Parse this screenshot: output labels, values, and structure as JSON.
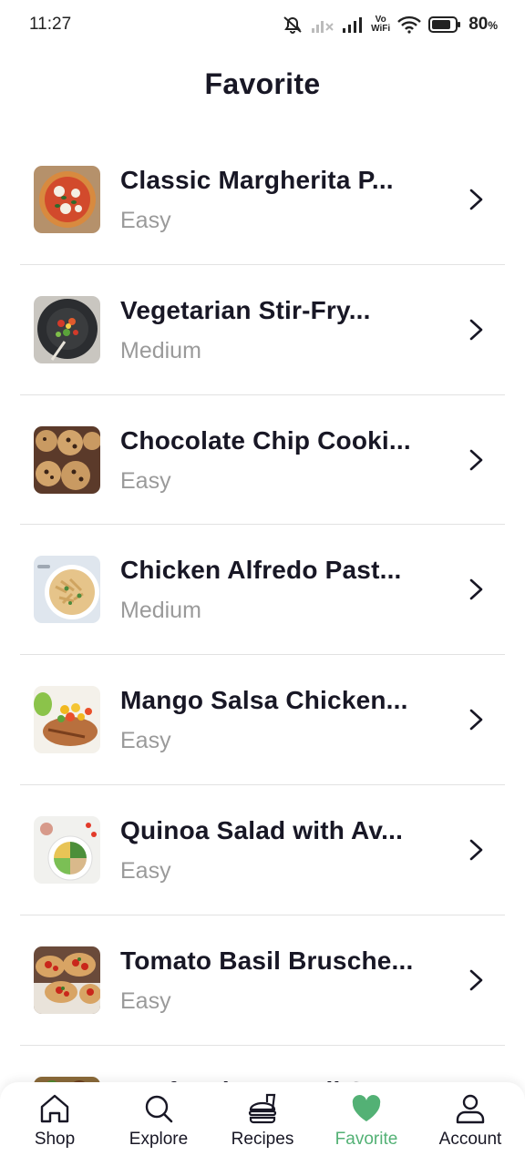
{
  "status_bar": {
    "time": "11:27",
    "vowifi_top": "Vo",
    "vowifi_bottom": "WiFi",
    "battery_percent": "80",
    "battery_unit": "%"
  },
  "page": {
    "title": "Favorite"
  },
  "favorites": [
    {
      "name": "Classic Margherita P...",
      "difficulty": "Easy",
      "thumb_icon": "pizza-image"
    },
    {
      "name": "Vegetarian Stir-Fry...",
      "difficulty": "Medium",
      "thumb_icon": "stir-fry-image"
    },
    {
      "name": "Chocolate Chip Cooki...",
      "difficulty": "Easy",
      "thumb_icon": "cookies-image"
    },
    {
      "name": "Chicken Alfredo Past...",
      "difficulty": "Medium",
      "thumb_icon": "pasta-image"
    },
    {
      "name": "Mango Salsa Chicken...",
      "difficulty": "Easy",
      "thumb_icon": "mango-chicken-image"
    },
    {
      "name": "Quinoa Salad with Av...",
      "difficulty": "Easy",
      "thumb_icon": "quinoa-salad-image"
    },
    {
      "name": "Tomato Basil Brusche...",
      "difficulty": "Easy",
      "thumb_icon": "bruschetta-image"
    },
    {
      "name": "Beef and Broccoli St...",
      "difficulty": "",
      "thumb_icon": "beef-broccoli-image"
    }
  ],
  "bottom_nav": {
    "items": [
      {
        "label": "Shop",
        "icon": "home-icon"
      },
      {
        "label": "Explore",
        "icon": "search-icon"
      },
      {
        "label": "Recipes",
        "icon": "recipes-icon"
      },
      {
        "label": "Favorite",
        "icon": "heart-icon",
        "active": true
      },
      {
        "label": "Account",
        "icon": "account-icon"
      }
    ]
  },
  "colors": {
    "accent": "#53b175",
    "text": "#181725",
    "muted": "#9a9a9a",
    "divider": "#e2e2e2"
  }
}
